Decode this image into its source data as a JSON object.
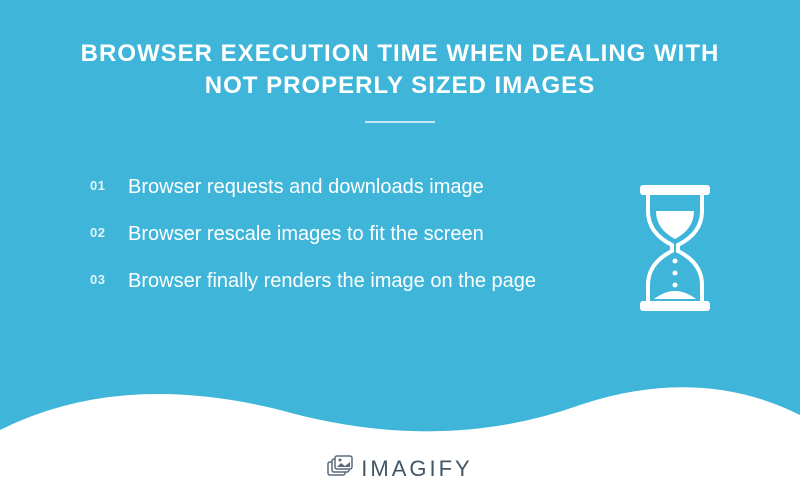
{
  "title_line1": "BROWSER EXECUTION TIME WHEN DEALING WITH",
  "title_line2": "NOT PROPERLY SIZED IMAGES",
  "steps": [
    {
      "num": "01",
      "text": "Browser requests and downloads image"
    },
    {
      "num": "02",
      "text": "Browser rescale images to fit the screen"
    },
    {
      "num": "03",
      "text": "Browser finally renders the image on the page"
    }
  ],
  "brand": "IMAGIFY"
}
